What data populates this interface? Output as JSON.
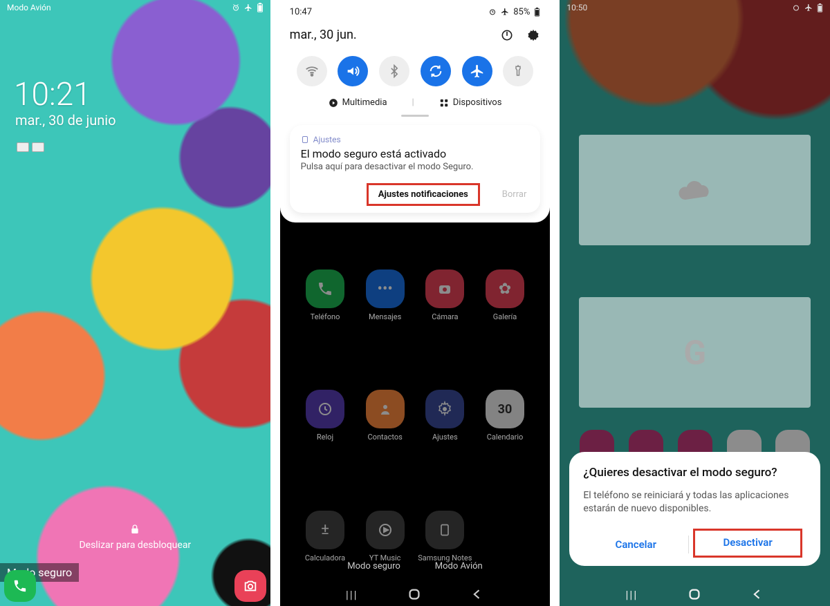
{
  "screen1": {
    "airplane_label": "Modo Avión",
    "time": "10:21",
    "date": "mar., 30 de junio",
    "unlock_hint": "Deslizar para desbloquear",
    "safe_mode": "Modo seguro"
  },
  "screen2": {
    "status_time": "10:47",
    "status_battery": "85%",
    "date": "mar., 30 jun.",
    "multimedia": "Multimedia",
    "devices": "Dispositivos",
    "notification": {
      "app": "Ajustes",
      "title": "El modo seguro está activado",
      "body": "Pulsa aquí para desactivar el modo Seguro.",
      "action_settings": "Ajustes notificaciones",
      "action_clear": "Borrar"
    },
    "apps": {
      "phone": "Teléfono",
      "messages": "Mensajes",
      "camera": "Cámara",
      "gallery": "Galería",
      "clock": "Reloj",
      "contacts": "Contactos",
      "settings": "Ajustes",
      "calendar": "Calendario",
      "calendar_day": "30",
      "calculator": "Calculadora",
      "ytmusic": "YT Music",
      "notes": "Samsung Notes"
    },
    "dock": {
      "safe_mode": "Modo seguro",
      "airplane": "Modo Avión"
    }
  },
  "screen3": {
    "status_time": "10:50",
    "widget_g": "G",
    "dialog": {
      "title": "¿Quieres desactivar el modo seguro?",
      "body": "El teléfono se reiniciará y todas las aplicaciones estarán de nuevo disponibles.",
      "cancel": "Cancelar",
      "confirm": "Desactivar"
    }
  }
}
